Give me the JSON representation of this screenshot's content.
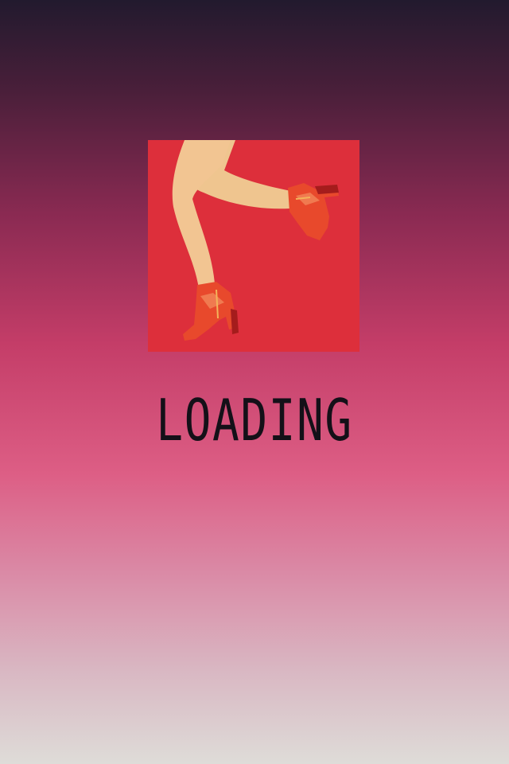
{
  "splash": {
    "logo_icon": "legs-high-heels-icon",
    "logo_background": "#dd2f3b",
    "loading_label": "LOADING"
  },
  "colors": {
    "gradient_top": "#221a2e",
    "gradient_mid": "#c43d68",
    "gradient_bottom": "#dedcd8",
    "text": "#141018"
  }
}
